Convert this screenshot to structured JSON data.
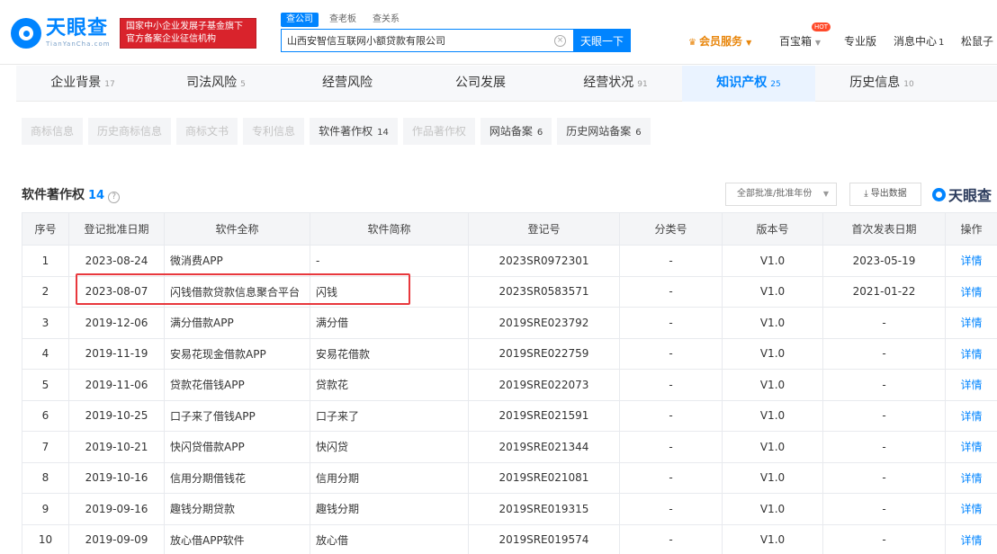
{
  "header": {
    "logo_name": "天眼查",
    "logo_sub": "TianYanCha.com",
    "banner_line1": "国家中小企业发展子基金旗下",
    "banner_line2": "官方备案企业征信机构",
    "search_tabs": [
      "查公司",
      "查老板",
      "查关系"
    ],
    "search_value": "山西安智信互联网小额贷款有限公司",
    "search_button": "天眼一下",
    "vip_label": "会员服务",
    "baibaoxiang": "百宝箱",
    "hot_badge": "HOT",
    "pro": "专业版",
    "messages": "消息中心",
    "messages_count": "1",
    "user": "松鼠子"
  },
  "main_tabs": [
    {
      "label": "企业背景",
      "count": "17"
    },
    {
      "label": "司法风险",
      "count": "5"
    },
    {
      "label": "经营风险",
      "count": ""
    },
    {
      "label": "公司发展",
      "count": ""
    },
    {
      "label": "经营状况",
      "count": "91"
    },
    {
      "label": "知识产权",
      "count": "25"
    },
    {
      "label": "历史信息",
      "count": "10"
    }
  ],
  "sub_tabs": [
    {
      "label": "商标信息",
      "count": "",
      "style": "muted"
    },
    {
      "label": "历史商标信息",
      "count": "",
      "style": "muted"
    },
    {
      "label": "商标文书",
      "count": "",
      "style": "muted"
    },
    {
      "label": "专利信息",
      "count": "",
      "style": "muted"
    },
    {
      "label": "软件著作权",
      "count": "14",
      "style": "dark"
    },
    {
      "label": "作品著作权",
      "count": "",
      "style": "muted"
    },
    {
      "label": "网站备案",
      "count": "6",
      "style": "dark"
    },
    {
      "label": "历史网站备案",
      "count": "6",
      "style": "dark"
    }
  ],
  "section": {
    "title": "软件著作权",
    "count": "14",
    "filter_label": "全部批准/批准年份",
    "export_label": "导出数据",
    "watermark": "天眼查"
  },
  "table": {
    "headers": [
      "序号",
      "登记批准日期",
      "软件全称",
      "软件简称",
      "登记号",
      "分类号",
      "版本号",
      "首次发表日期",
      "操作"
    ],
    "rows": [
      [
        "1",
        "2023-08-24",
        "微消费APP",
        "-",
        "2023SR0972301",
        "-",
        "V1.0",
        "2023-05-19",
        "详情"
      ],
      [
        "2",
        "2023-08-07",
        "闪钱借款贷款信息聚合平台",
        "闪钱",
        "2023SR0583571",
        "-",
        "V1.0",
        "2021-01-22",
        "详情"
      ],
      [
        "3",
        "2019-12-06",
        "满分借款APP",
        "满分借",
        "2019SRE023792",
        "-",
        "V1.0",
        "-",
        "详情"
      ],
      [
        "4",
        "2019-11-19",
        "安易花现金借款APP",
        "安易花借款",
        "2019SRE022759",
        "-",
        "V1.0",
        "-",
        "详情"
      ],
      [
        "5",
        "2019-11-06",
        "贷款花借钱APP",
        "贷款花",
        "2019SRE022073",
        "-",
        "V1.0",
        "-",
        "详情"
      ],
      [
        "6",
        "2019-10-25",
        "口子来了借钱APP",
        "口子来了",
        "2019SRE021591",
        "-",
        "V1.0",
        "-",
        "详情"
      ],
      [
        "7",
        "2019-10-21",
        "快闪贷借款APP",
        "快闪贷",
        "2019SRE021344",
        "-",
        "V1.0",
        "-",
        "详情"
      ],
      [
        "8",
        "2019-10-16",
        "信用分期借钱花",
        "信用分期",
        "2019SRE021081",
        "-",
        "V1.0",
        "-",
        "详情"
      ],
      [
        "9",
        "2019-09-16",
        "趣钱分期贷款",
        "趣钱分期",
        "2019SRE019315",
        "-",
        "V1.0",
        "-",
        "详情"
      ],
      [
        "10",
        "2019-09-09",
        "放心借APP软件",
        "放心借",
        "2019SRE019574",
        "-",
        "V1.0",
        "-",
        "详情"
      ]
    ]
  },
  "colors": {
    "brand": "#0084ff",
    "highlight": "#e8383d"
  }
}
